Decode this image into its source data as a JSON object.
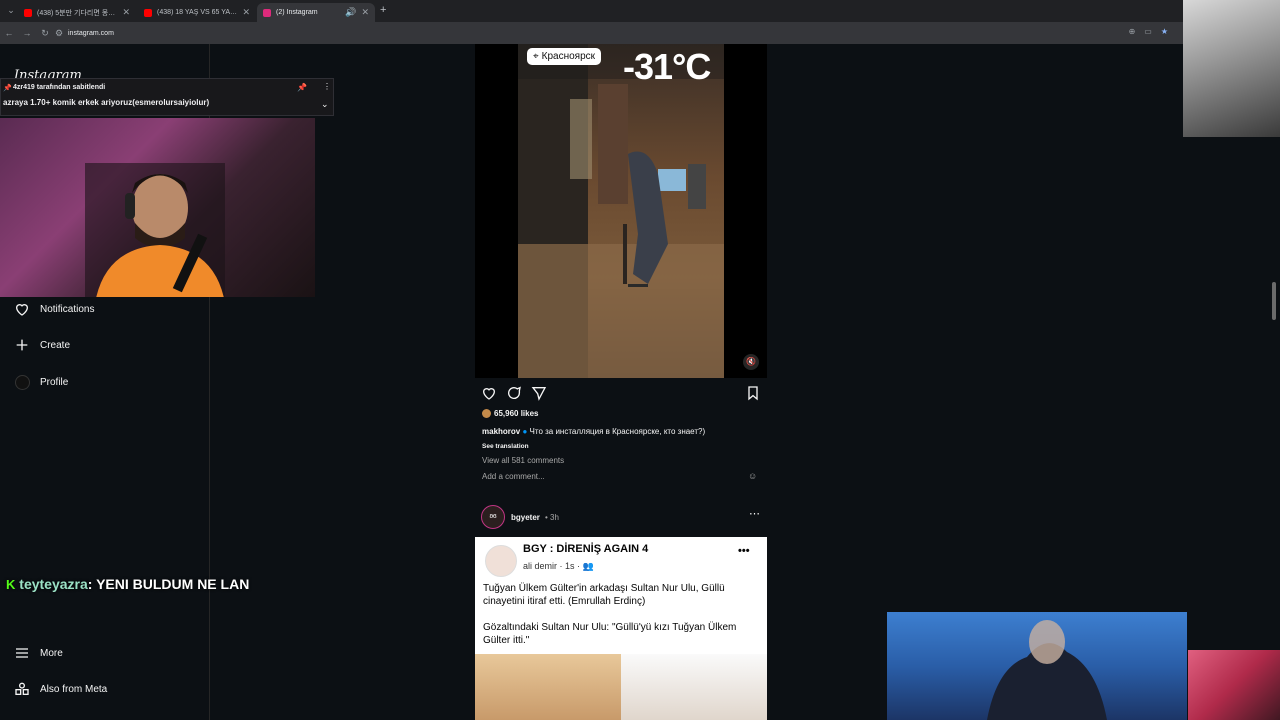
{
  "browser": {
    "tabs": [
      {
        "label": "(438) 5분만 기다리면 몽중이 바뀐",
        "active": false,
        "favicon_color": "#ff0000"
      },
      {
        "label": "(438) 18 YAŞ VS 65 YAŞ YARIŞM",
        "active": false,
        "favicon_color": "#ff0000"
      },
      {
        "label": "(2) Instagram",
        "active": true,
        "favicon_color": "#dd2a7b"
      }
    ],
    "url": "instagram.com"
  },
  "sidebar": {
    "logo": "Instagram",
    "items": [
      {
        "label": "Notifications",
        "icon": "heart-icon"
      },
      {
        "label": "Create",
        "icon": "plus-icon"
      },
      {
        "label": "Profile",
        "icon": "avatar"
      },
      {
        "label": "More",
        "icon": "menu-icon"
      },
      {
        "label": "Also from Meta",
        "icon": "meta-icon"
      }
    ]
  },
  "stream_overlay": {
    "pinned_by": "4zr419 tarafından sabitlendi",
    "pinned_message": "azraya 1.70+ komik erkek ariyoruz(esmerolursaiyiolur)",
    "chat_user": "teyteyazra",
    "chat_text": ": YENI BULDUM NE LAN"
  },
  "post1": {
    "location": "Красноярск",
    "temperature": "-31°C",
    "likes": "65,960 likes",
    "username": "makhorov",
    "caption": "Что за инсталляция в Красноярске, кто знает?)",
    "see_translation": "See translation",
    "view_comments": "View all 581 comments",
    "add_comment": "Add a comment..."
  },
  "post2": {
    "username": "bgyeter",
    "time": "• 3h",
    "group_name": "BGY : DİRENİŞ AGAIN 4",
    "author": "ali demir · 1s ·",
    "text1": "Tuğyan Ülkem Gülter'in arkadaşı Sultan Nur Ulu, Güllü cinayetini itiraf etti. (Emrullah Erdinç)",
    "text2": "Gözaltındaki Sultan Nur Ulu: \"Güllü'yü kızı Tuğyan Ülkem Gülter itti.\""
  },
  "colors": {
    "background": "#0c1014",
    "chat_user": "#9be2c6",
    "verified": "#0095f6"
  }
}
